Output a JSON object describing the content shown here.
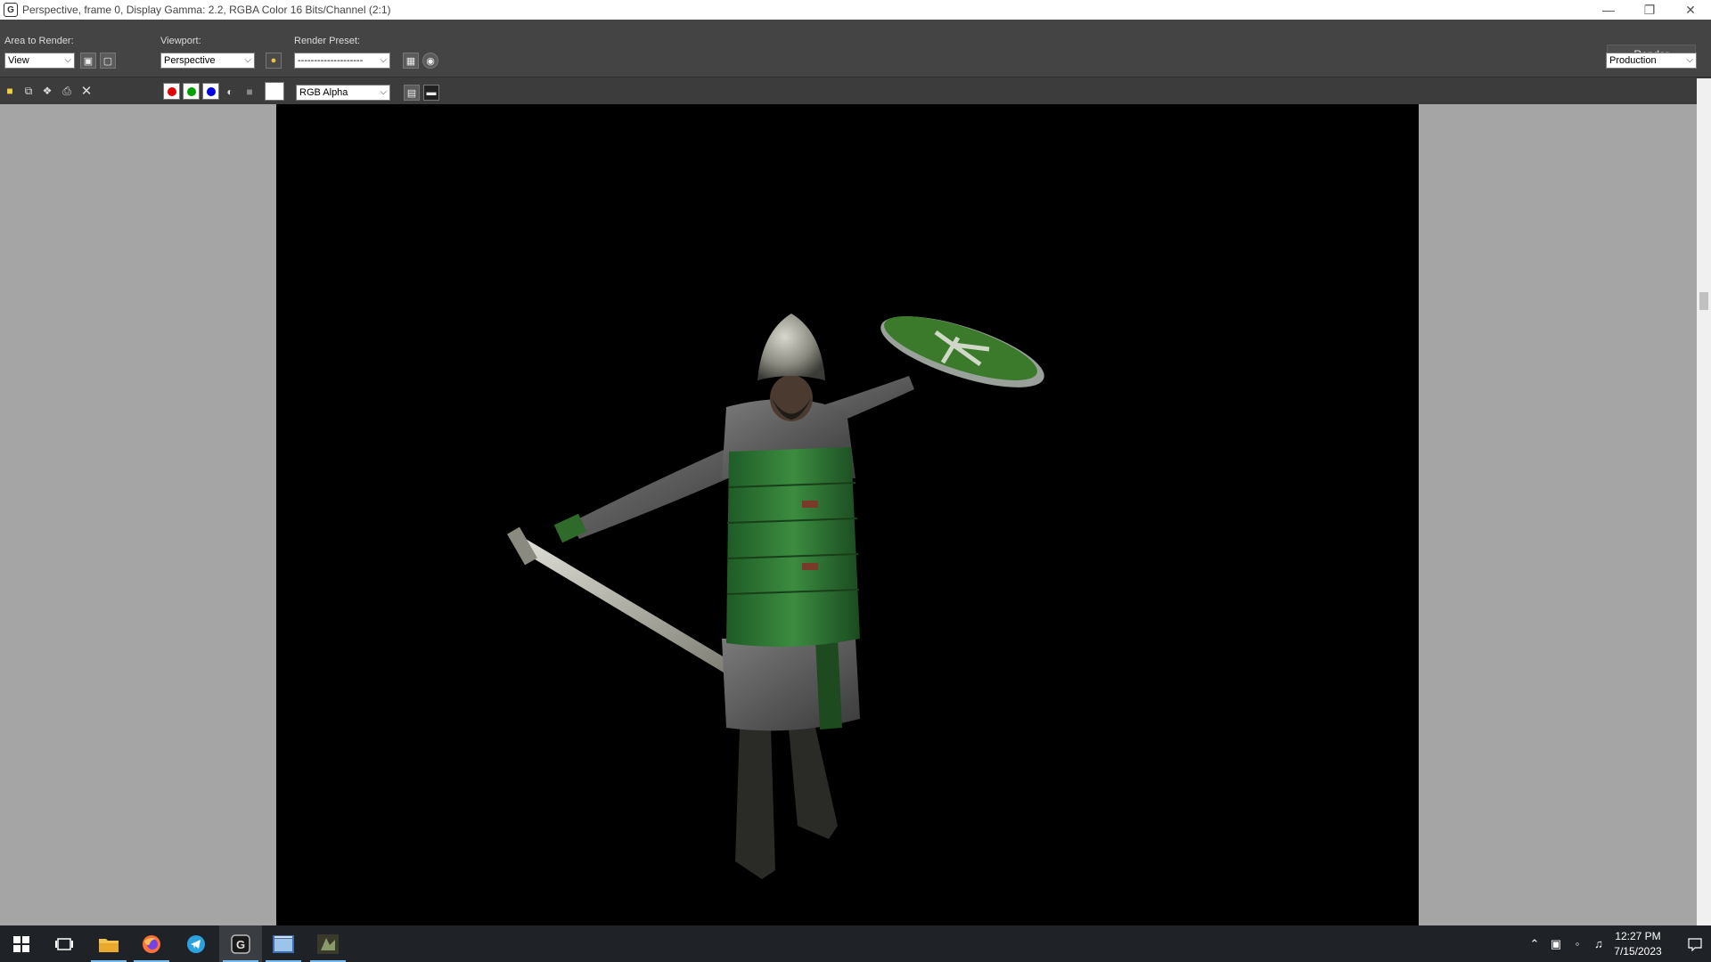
{
  "window": {
    "title": "Perspective, frame 0, Display Gamma: 2.2, RGBA Color 16 Bits/Channel (2:1)",
    "icon_letter": "G"
  },
  "toolbar": {
    "area_to_render_label": "Area to Render:",
    "area_to_render_value": "View",
    "viewport_label": "Viewport:",
    "viewport_value": "Perspective",
    "render_preset_label": "Render Preset:",
    "render_preset_value": "--------------------",
    "render_button": "Render",
    "mode_value": "Production"
  },
  "channel_bar": {
    "channel_display_value": "RGB Alpha",
    "channels": [
      {
        "name": "red",
        "color": "#e00000"
      },
      {
        "name": "green",
        "color": "#00a000"
      },
      {
        "name": "blue",
        "color": "#0000e0"
      }
    ],
    "swatch_color": "#ffffff"
  },
  "taskbar": {
    "apps": [
      "start-icon",
      "task-view-icon",
      "file-explorer-icon",
      "firefox-icon",
      "telegram-icon",
      "3dsmax-icon",
      "image-viewer-icon",
      "game-icon"
    ],
    "time": "12:27 PM",
    "date": "7/15/2023"
  },
  "colors": {
    "toolbar_bg": "#444444",
    "viewport_bg": "#a5a5a5",
    "render_bg": "#000000",
    "taskbar_bg": "#1f2227",
    "accent": "#76b9ed"
  }
}
